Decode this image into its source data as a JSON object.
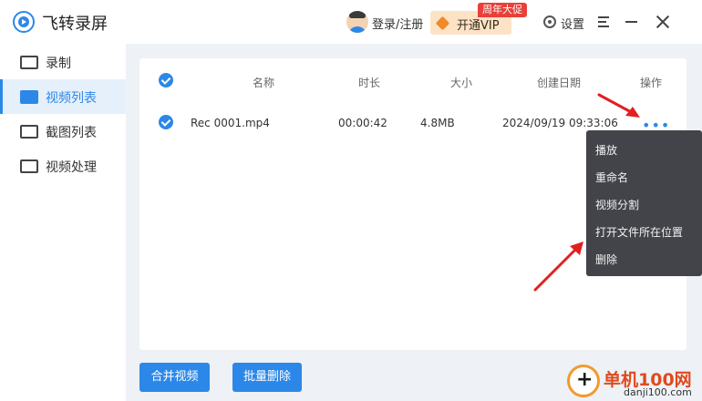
{
  "app": {
    "title": "飞转录屏"
  },
  "header": {
    "login_label": "登录/注册",
    "vip_label": "开通VIP",
    "promo_badge": "周年大促",
    "settings_label": "设置"
  },
  "sidebar": {
    "items": [
      {
        "label": "录制",
        "icon": "record-icon",
        "active": false
      },
      {
        "label": "视频列表",
        "icon": "video-list-icon",
        "active": true
      },
      {
        "label": "截图列表",
        "icon": "screenshot-list-icon",
        "active": false
      },
      {
        "label": "视频处理",
        "icon": "video-process-icon",
        "active": false
      }
    ]
  },
  "table": {
    "columns": [
      "名称",
      "时长",
      "大小",
      "创建日期",
      "操作"
    ],
    "rows": [
      {
        "name": "Rec 0001.mp4",
        "duration": "00:00:42",
        "size": "4.8MB",
        "created": "2024/09/19 09:33:06",
        "selected": true
      }
    ],
    "header_checked": true
  },
  "context_menu": {
    "items": [
      "播放",
      "重命名",
      "视频分割",
      "打开文件所在位置",
      "删除"
    ]
  },
  "buttons": {
    "merge": "合并视频",
    "batch_delete": "批量删除"
  },
  "watermark": {
    "text": "单机100网",
    "domain": "danji100.com"
  },
  "colors": {
    "accent": "#2c88e8",
    "menu_bg": "#43444a",
    "promo": "#e8403a",
    "vip_bg": "#fde3c6",
    "arrow": "#e02020"
  }
}
